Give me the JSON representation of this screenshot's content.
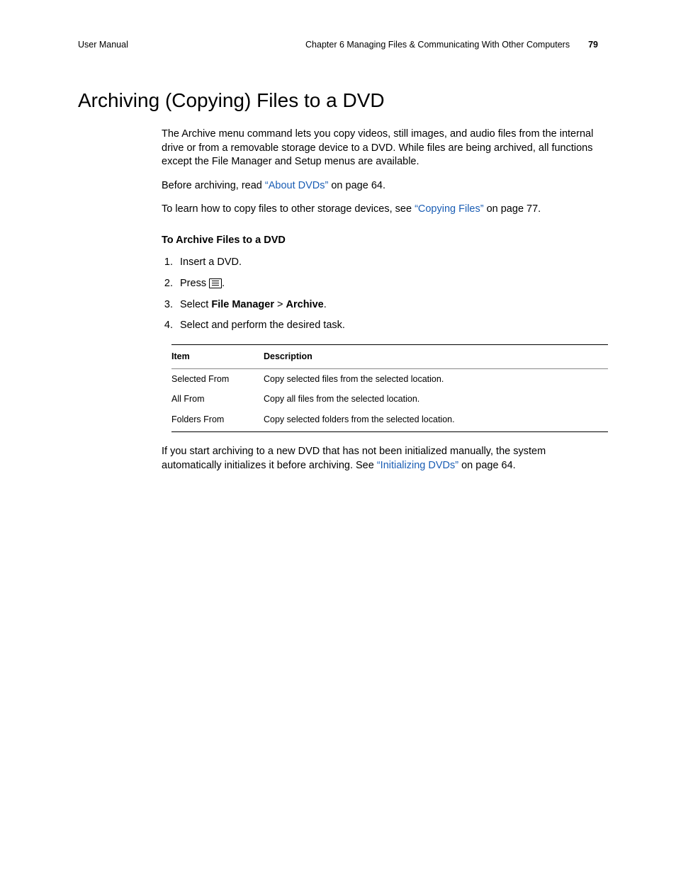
{
  "header": {
    "left": "User Manual",
    "chapter": "Chapter 6    Managing Files & Communicating With Other Computers",
    "page_number": "79"
  },
  "title": "Archiving (Copying) Files to a DVD",
  "paragraphs": {
    "intro": "The Archive menu command lets you copy videos, still images, and audio files from the internal drive or from a removable storage device to a DVD. While files are being archived, all functions except the File Manager and Setup menus are available.",
    "before_pre": "Before archiving, read ",
    "about_dvds": "“About DVDs”",
    "before_post": " on page 64.",
    "learn_pre": "To learn how to copy files to other storage devices, see ",
    "copying_files": "“Copying Files”",
    "learn_post": " on page 77.",
    "procedure_heading": "To Archive Files to a DVD",
    "step1": "Insert a DVD.",
    "step2_pre": "Press ",
    "step2_post": ".",
    "step3_pre": "Select ",
    "step3_b1": "File Manager",
    "step3_mid": " > ",
    "step3_b2": "Archive",
    "step3_post": ".",
    "step4": "Select and perform the desired task.",
    "note_pre": "If you start archiving to a new DVD that has not been initialized manually, the system automatically initializes it before archiving. See ",
    "init_dvds": "“Initializing DVDs”",
    "note_post": " on page 64."
  },
  "table": {
    "headers": {
      "item": "Item",
      "desc": "Description"
    },
    "rows": [
      {
        "item": "Selected From",
        "desc": "Copy selected files from the selected location."
      },
      {
        "item": "All From",
        "desc": "Copy all files from the selected location."
      },
      {
        "item": "Folders From",
        "desc": "Copy selected folders from the selected location."
      }
    ]
  }
}
